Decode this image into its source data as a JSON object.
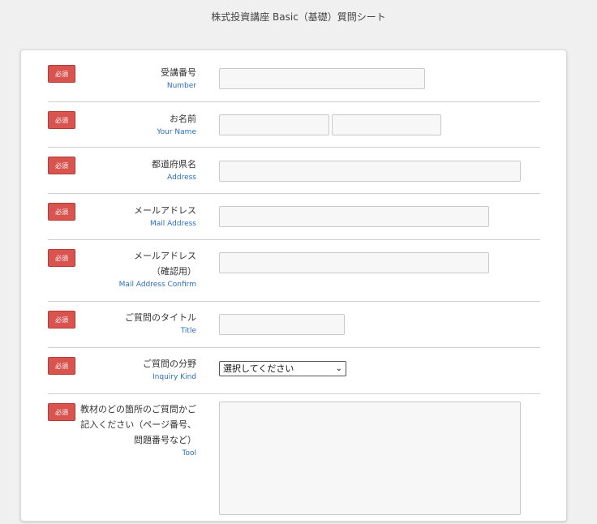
{
  "page": {
    "title": "株式投資講座 Basic（基礎）質問シート"
  },
  "required_label": "必須",
  "fields": {
    "number": {
      "label": "受講番号",
      "sub": "Number",
      "value": ""
    },
    "name": {
      "label": "お名前",
      "sub": "Your Name",
      "first_value": "",
      "last_value": ""
    },
    "address": {
      "label": "都道府県名",
      "sub": "Address",
      "value": ""
    },
    "mail": {
      "label": "メールアドレス",
      "sub": "Mail Address",
      "value": ""
    },
    "mail_confirm": {
      "label_line1": "メールアドレス",
      "label_line2": "（確認用）",
      "sub": "Mail Address Confirm",
      "value": ""
    },
    "title": {
      "label": "ご質問のタイトル",
      "sub": "Title",
      "value": ""
    },
    "kind": {
      "label": "ご質問の分野",
      "sub": "Inquiry Kind",
      "selected": "選択してください"
    },
    "tool": {
      "label_line1": "教材のどの箇所のご質問かご",
      "label_line2": "記入ください（ページ番号、",
      "label_line3": "問題番号など）",
      "sub": "Tool",
      "value": ""
    }
  }
}
